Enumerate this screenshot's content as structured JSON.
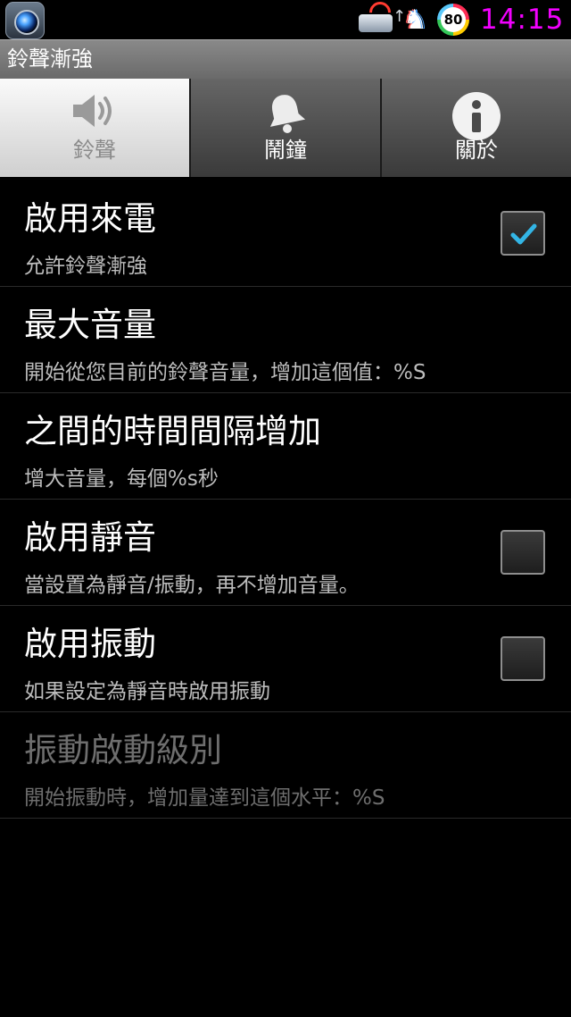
{
  "status_bar": {
    "time": "14:15",
    "battery_level": "80",
    "icons": [
      "camera-app-icon",
      "wifi-router-icon",
      "upload-arrow-icon",
      "horse-icon",
      "battery-badge"
    ]
  },
  "title_bar": {
    "title": "鈴聲漸強"
  },
  "tabs": [
    {
      "label": "鈴聲",
      "icon": "speaker-icon",
      "active": true
    },
    {
      "label": "鬧鐘",
      "icon": "bell-icon",
      "active": false
    },
    {
      "label": "關於",
      "icon": "info-icon",
      "active": false
    }
  ],
  "settings": [
    {
      "title": "啟用來電",
      "summary": "允許鈴聲漸強",
      "checkbox": true,
      "checked": true,
      "enabled": true
    },
    {
      "title": "最大音量",
      "summary": "開始從您目前的鈴聲音量，增加這個值：%S",
      "checkbox": false,
      "enabled": true
    },
    {
      "title": "之間的時間間隔增加",
      "summary": "增大音量，每個%s秒",
      "checkbox": false,
      "enabled": true
    },
    {
      "title": "啟用靜音",
      "summary": "當設置為靜音/振動，再不增加音量。",
      "checkbox": true,
      "checked": false,
      "enabled": true
    },
    {
      "title": "啟用振動",
      "summary": "如果設定為靜音時啟用振動",
      "checkbox": true,
      "checked": false,
      "enabled": true
    },
    {
      "title": "振動啟動級別",
      "summary": "開始振動時，增加量達到這個水平：%S",
      "checkbox": false,
      "enabled": false
    }
  ],
  "colors": {
    "clock": "#f200ff",
    "check_accent": "#33b5e5",
    "title_bar": "#7a7a7a",
    "active_tab": "#e8e8e8"
  }
}
